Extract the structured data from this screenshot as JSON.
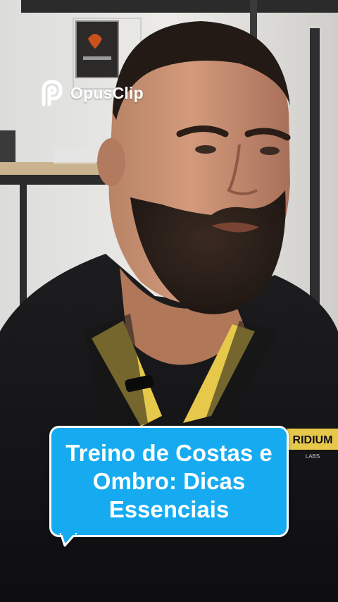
{
  "watermark": {
    "brand": "OpusClip",
    "icon": "opusclip-logo-icon"
  },
  "caption": {
    "text": "Treino de Costas e Ombro: Dicas Essenciais"
  },
  "scene": {
    "shirt_logo_text": "RIDIUM",
    "shirt_logo_subtext": "LABS",
    "background_sign_text": "IRIDIUM",
    "colors": {
      "caption_fill": "#16abf0",
      "caption_border": "#ffffff",
      "shirt": "#121212",
      "collar_accent": "#e6c84a"
    }
  }
}
